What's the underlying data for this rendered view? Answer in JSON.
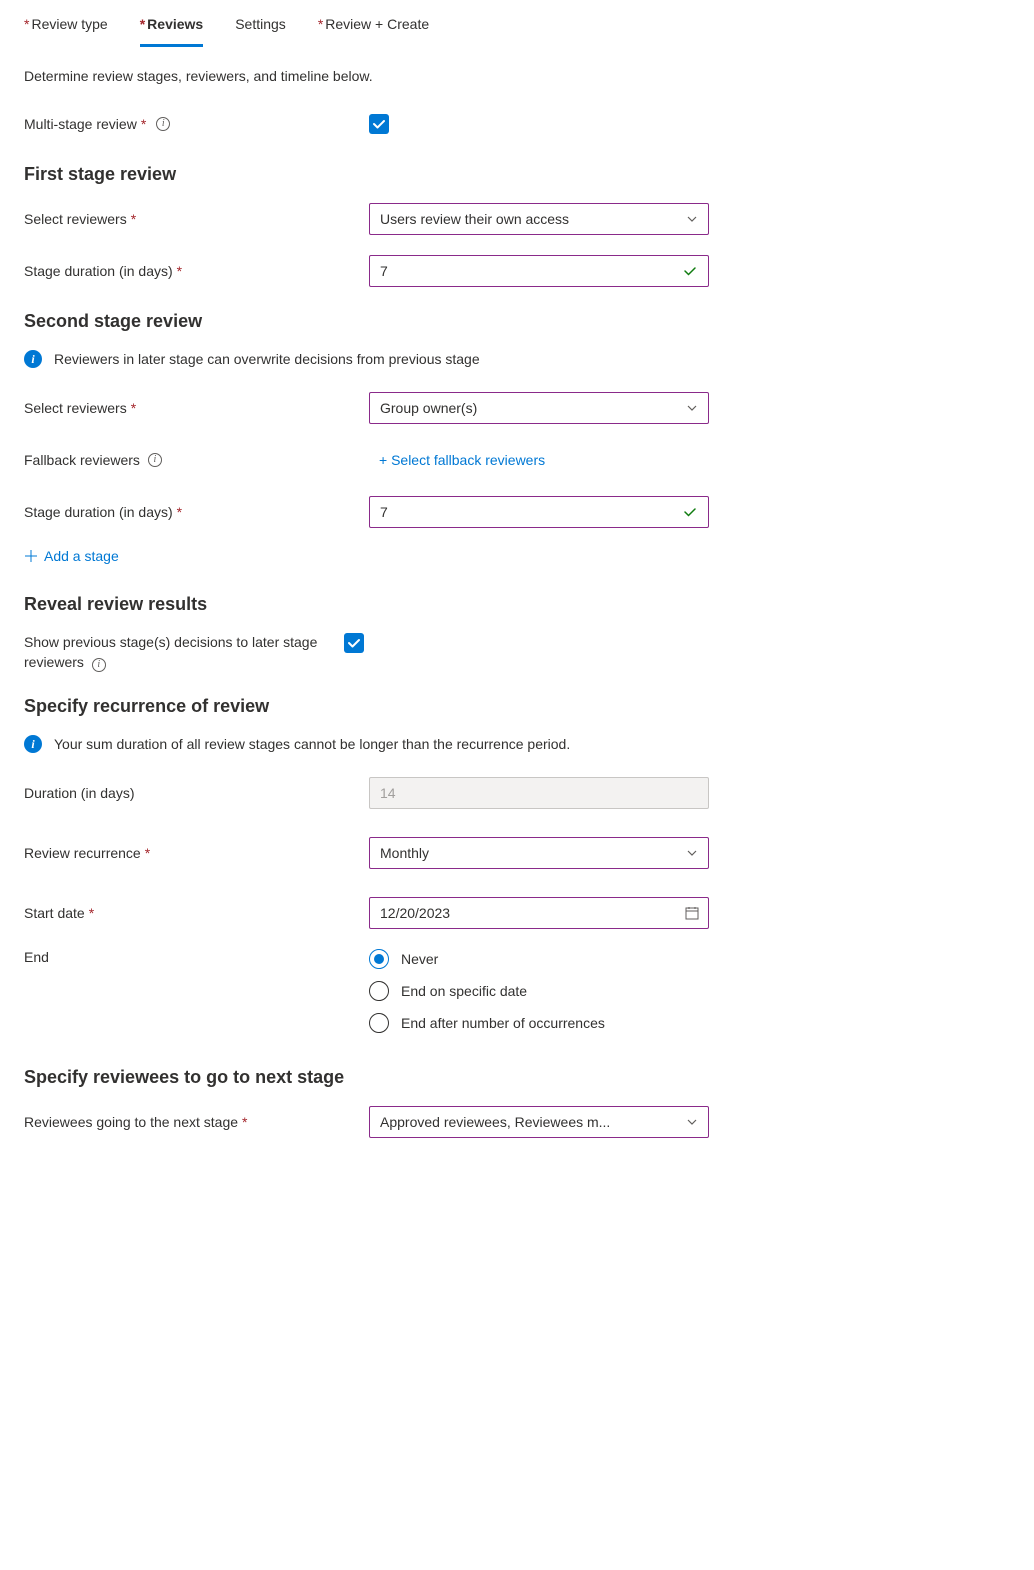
{
  "tabs": {
    "review_type": "Review type",
    "reviews": "Reviews",
    "settings": "Settings",
    "review_create": "Review + Create"
  },
  "intro": "Determine review stages, reviewers, and timeline below.",
  "multiStage": {
    "label": "Multi-stage review",
    "checked": true
  },
  "firstStage": {
    "heading": "First stage review",
    "selectReviewersLabel": "Select reviewers",
    "selectReviewersValue": "Users review their own access",
    "durationLabel": "Stage duration (in days)",
    "durationValue": "7"
  },
  "secondStage": {
    "heading": "Second stage review",
    "info": "Reviewers in later stage can overwrite decisions from previous stage",
    "selectReviewersLabel": "Select reviewers",
    "selectReviewersValue": "Group owner(s)",
    "fallbackLabel": "Fallback reviewers",
    "fallbackLink": "+ Select fallback reviewers",
    "durationLabel": "Stage duration (in days)",
    "durationValue": "7"
  },
  "addStage": "Add a stage",
  "reveal": {
    "heading": "Reveal review results",
    "label": "Show previous stage(s) decisions to later stage reviewers",
    "checked": true
  },
  "recurrence": {
    "heading": "Specify recurrence of review",
    "info": "Your sum duration of all review stages cannot be longer than the recurrence period.",
    "durationLabel": "Duration (in days)",
    "durationValue": "14",
    "reviewRecurrenceLabel": "Review recurrence",
    "reviewRecurrenceValue": "Monthly",
    "startDateLabel": "Start date",
    "startDateValue": "12/20/2023",
    "endLabel": "End",
    "endOptions": {
      "never": "Never",
      "specific": "End on specific date",
      "occurrences": "End after number of occurrences"
    },
    "endSelected": "never"
  },
  "nextStage": {
    "heading": "Specify reviewees to go to next stage",
    "label": "Reviewees going to the next stage",
    "value": "Approved reviewees, Reviewees m..."
  }
}
